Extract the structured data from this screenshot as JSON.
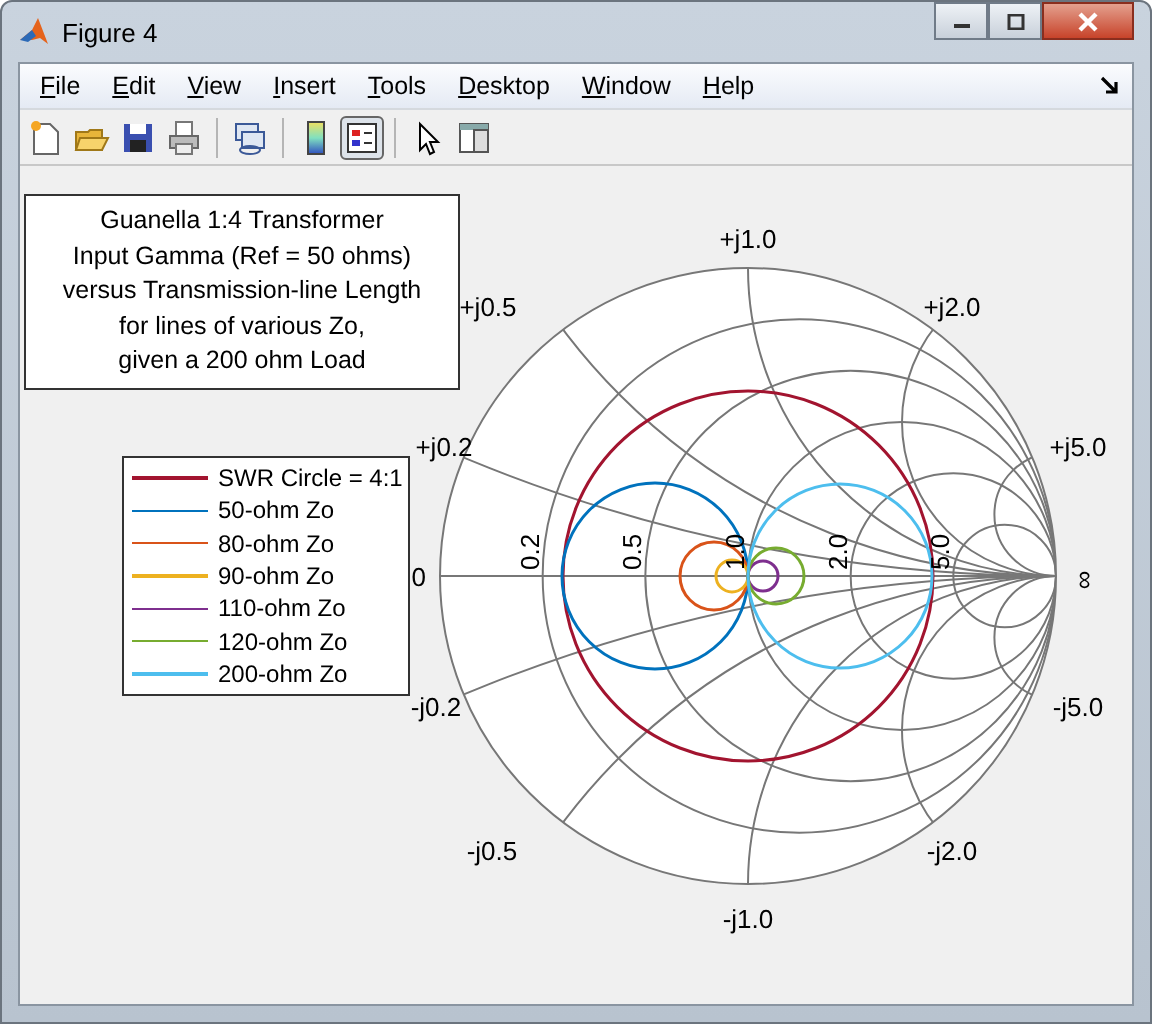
{
  "window": {
    "title": "Figure 4"
  },
  "menu": [
    {
      "label": "File"
    },
    {
      "label": "Edit"
    },
    {
      "label": "View"
    },
    {
      "label": "Insert"
    },
    {
      "label": "Tools"
    },
    {
      "label": "Desktop"
    },
    {
      "label": "Window"
    },
    {
      "label": "Help"
    }
  ],
  "toolbar": [
    {
      "kind": "new",
      "selected": false
    },
    {
      "kind": "open",
      "selected": false
    },
    {
      "kind": "save",
      "selected": false
    },
    {
      "kind": "print",
      "selected": false
    },
    {
      "kind": "separator"
    },
    {
      "kind": "link",
      "selected": false
    },
    {
      "kind": "separator"
    },
    {
      "kind": "colorbar",
      "selected": false
    },
    {
      "kind": "legend",
      "selected": true
    },
    {
      "kind": "separator"
    },
    {
      "kind": "pointer",
      "selected": false
    },
    {
      "kind": "property",
      "selected": false
    }
  ],
  "annotation": [
    "Guanella 1:4 Transformer",
    "Input Gamma (Ref = 50 ohms)",
    "versus Transmission-line Length",
    "for lines of various Zo,",
    "given a 200 ohm Load"
  ],
  "legend": [
    {
      "label": "SWR Circle = 4:1",
      "color": "#a2142f"
    },
    {
      "label": "50-ohm Zo",
      "color": "#0072bd"
    },
    {
      "label": "80-ohm Zo",
      "color": "#d95319"
    },
    {
      "label": "90-ohm Zo",
      "color": "#edb120"
    },
    {
      "label": "110-ohm Zo",
      "color": "#7e2f8e"
    },
    {
      "label": "120-ohm Zo",
      "color": "#77ac30"
    },
    {
      "label": "200-ohm Zo",
      "color": "#4dbeee"
    }
  ],
  "smith_chart": {
    "reactance_labels": [
      "+j1.0",
      "+j0.5",
      "+j2.0",
      "+j0.2",
      "+j5.0",
      "0",
      "∞",
      "-j0.2",
      "-j5.0",
      "-j0.5",
      "-j2.0",
      "-j1.0"
    ],
    "resistance_labels": [
      "0.2",
      "0.5",
      "1.0",
      "2.0",
      "5.0"
    ]
  }
}
